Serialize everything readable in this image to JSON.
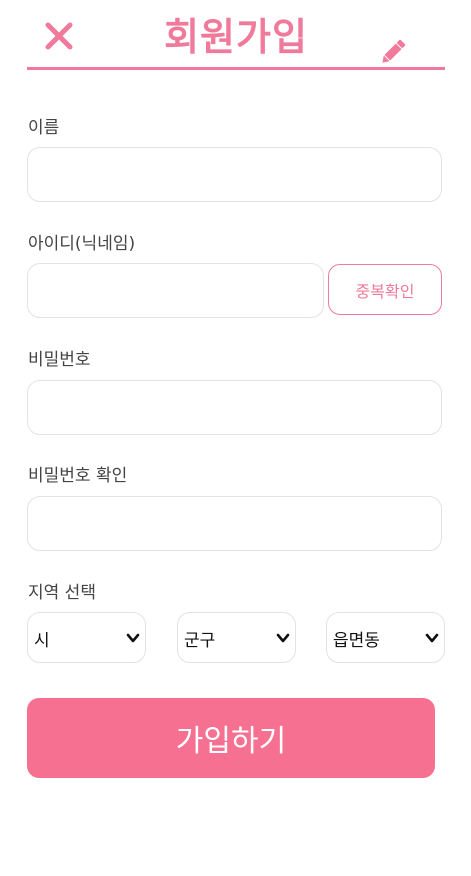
{
  "header": {
    "title": "회원가입"
  },
  "form": {
    "name_label": "이름",
    "name_value": "",
    "id_label": "아이디(닉네임)",
    "id_value": "",
    "dup_check_label": "중복확인",
    "password_label": "비밀번호",
    "password_value": "",
    "password_confirm_label": "비밀번호 확인",
    "password_confirm_value": "",
    "region_label": "지역 선택",
    "region": {
      "city": "시",
      "district": "군구",
      "town": "읍면동"
    },
    "submit_label": "가입하기"
  },
  "colors": {
    "accent": "#f07a9b",
    "button": "#f67191",
    "border": "#e3e3e3"
  }
}
